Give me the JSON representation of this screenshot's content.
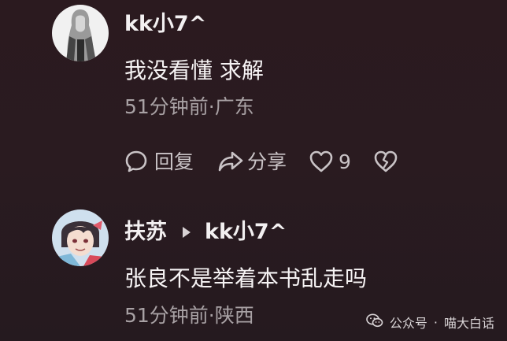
{
  "comments": [
    {
      "username": "kk小7^",
      "text": "我没看懂 求解",
      "meta": "51分钟前·广东",
      "actions": {
        "reply_label": "回复",
        "share_label": "分享",
        "like_count": "9"
      }
    },
    {
      "username": "扶苏",
      "reply_to": "kk小7^",
      "text": "张良不是举着本书乱走吗",
      "meta": "51分钟前·陕西"
    }
  ],
  "watermark": {
    "source": "公众号",
    "separator": "·",
    "account": "喵大白话"
  },
  "icons": {
    "reply": "speech-bubble-icon",
    "share": "share-arrow-icon",
    "like": "heart-outline-icon",
    "dislike": "broken-heart-icon",
    "wechat": "wechat-logo-icon"
  }
}
